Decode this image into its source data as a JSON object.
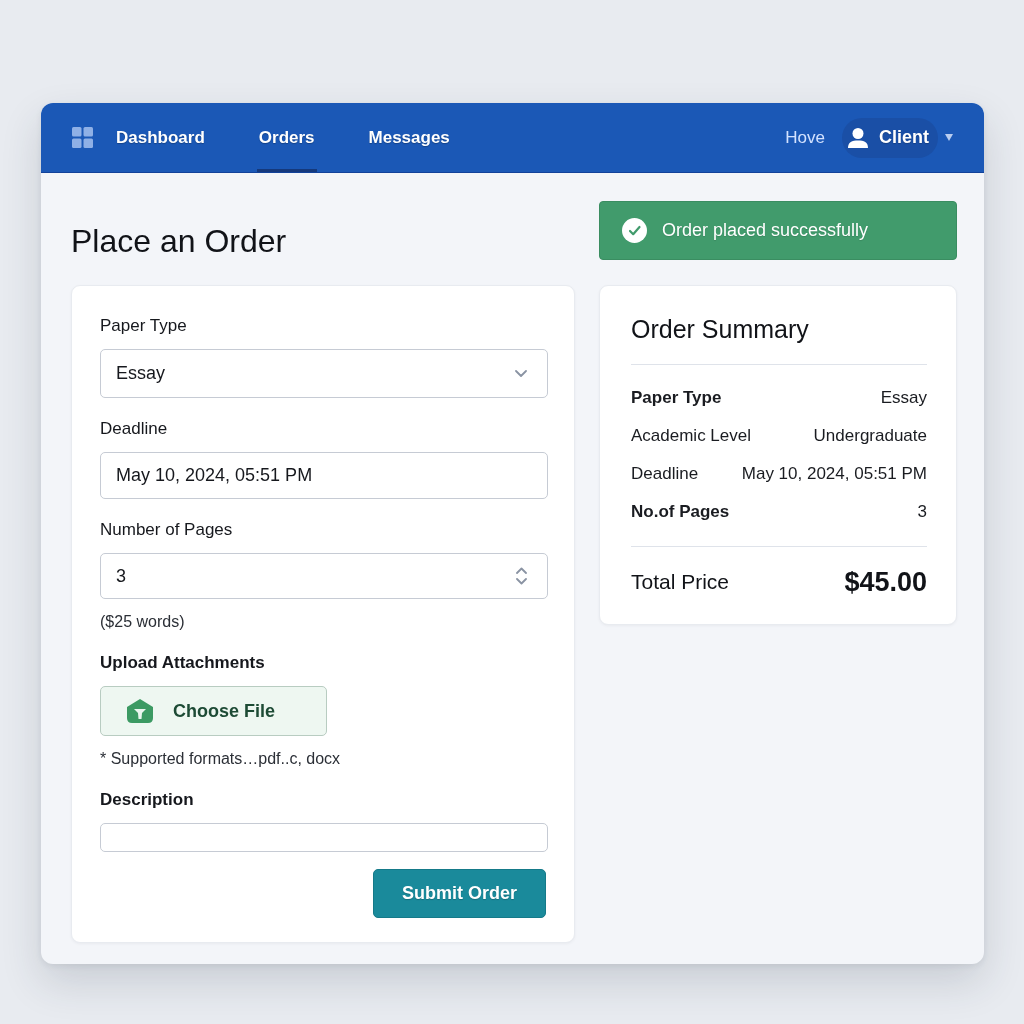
{
  "nav": {
    "tabs": [
      {
        "label": "Dashboard",
        "selected": false
      },
      {
        "label": "Orders",
        "selected": true
      },
      {
        "label": "Messages",
        "selected": false
      }
    ],
    "link": "Hove",
    "user": "Client"
  },
  "page": {
    "title": "Place an Order"
  },
  "alert": {
    "kind": "success",
    "text": "Order placed successfully"
  },
  "form": {
    "fields": [
      {
        "kind": "select",
        "label": "Paper Type",
        "bold": false,
        "value": "Essay"
      },
      {
        "kind": "text",
        "label": "Deadline",
        "bold": false,
        "value": "May 10, 2024, 05:51 PM"
      },
      {
        "kind": "number",
        "label": "Number of Pages",
        "bold": false,
        "value": "3",
        "hint": "($25 words)"
      },
      {
        "kind": "file",
        "label": "Upload Attachments",
        "bold": true,
        "button": "Choose File",
        "hint": "* Supported formats…pdf..c, docx"
      },
      {
        "kind": "textarea",
        "label": "Description",
        "bold": true
      }
    ],
    "submit": "Submit Order"
  },
  "summary": {
    "title": "Order Summary",
    "rows": [
      {
        "label": "Paper Type",
        "value": "Essay",
        "bold": true
      },
      {
        "label": "Academic Level",
        "value": "Undergraduate",
        "bold": false
      },
      {
        "label": "Deadline",
        "value": "May 10, 2024, 05:51 PM",
        "bold": false
      },
      {
        "label": "No.of Pages",
        "value": "3",
        "bold": true
      }
    ],
    "total": {
      "label": "Total Price",
      "value": "$45.00"
    }
  }
}
